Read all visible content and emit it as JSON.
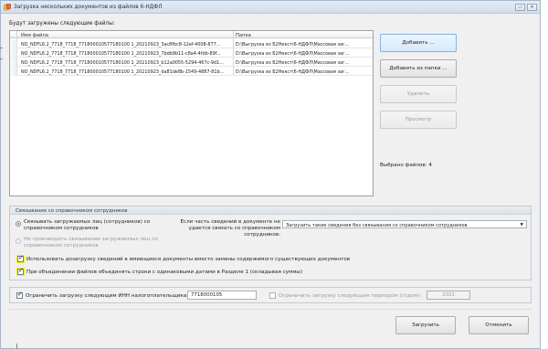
{
  "window": {
    "title": "Загрузка нескольких документов из файлов 6-НДФЛ"
  },
  "files_label": "Будут загружены следующие файлы:",
  "grid": {
    "columns": [
      "Имя файла",
      "Папка"
    ],
    "rows": [
      [
        "NO_NDFL6.2_7718_7718_771800010577180100 1_20210923_3ac8fbc8-12ef-4008-877...",
        "D:\\Выгрузка из Б2Некст\\6-НДФЛ\\Массовая заг..."
      ],
      [
        "NO_NDFL6.2_7718_7718_771800010577180100 1_20210923_7bdb9b11-c8a4-4fdb-89f...",
        "D:\\Выгрузка из Б2Некст\\6-НДФЛ\\Массовая заг..."
      ],
      [
        "NO_NDFL6.2_7718_7718_771800010577180100 1_20210923_b12a0055-5294-467c-9d1...",
        "D:\\Выгрузка из Б2Некст\\6-НДФЛ\\Массовая заг..."
      ],
      [
        "NO_NDFL6.2_7718_7718_771800010577180100 1_20210923_da81de8b-1549-4887-81b...",
        "D:\\Выгрузка из Б2Некст\\6-НДФЛ\\Массовая заг..."
      ]
    ]
  },
  "side_buttons": {
    "add": "Добавить ...",
    "add_from_folder": "Добавить из папки ...",
    "delete": "Удалить",
    "preview": "Просмотр"
  },
  "selected_count": "Выбрано файлов: 4",
  "link_group": {
    "title": "Связывание со справочником сотрудников",
    "radio_link": "Связывать загружаемых лиц (сотрудников) со справочником сотрудников",
    "radio_no_link": "Не производить связывание загружаемых лиц со справочником сотрудников",
    "partial_label": "Если часть сведений в документе не удается связать со справочником сотрудников:",
    "partial_select": "Загрузить такие сведения без связывания со справочником сотрудников"
  },
  "options": {
    "use_existing": "Использовать дозагрузку сведений в имеющиеся документы вместо замены содержимого существующих документов",
    "merge_rows": "При объединении файлов объединять строки с одинаковыми датами в Разделе 1 (складывая суммы)"
  },
  "restrict": {
    "inn_label": "Ограничить загрузку следующим ИНН налогоплательщика:",
    "inn_value": "7718000105",
    "period_label": "Ограничить загрузку следующим периодом (годом):",
    "period_value": "2021"
  },
  "footer": {
    "load": "Загрузить",
    "cancel": "Отменить"
  },
  "colors": {
    "highlight": "#f6f600",
    "primary_border": "#7eb4ea",
    "window_bg": "#f0f0f0"
  }
}
